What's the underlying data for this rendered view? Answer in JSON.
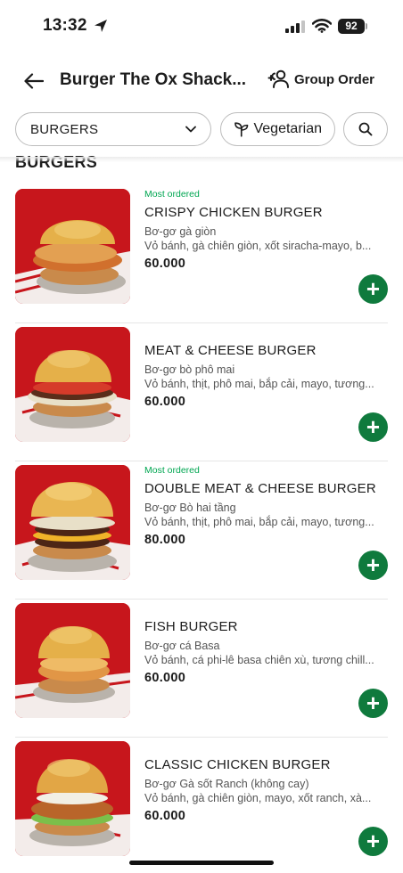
{
  "status_bar": {
    "time": "13:32",
    "battery": "92"
  },
  "header": {
    "title": "Burger The Ox Shack...",
    "group_order_label": "Group Order"
  },
  "filters": {
    "category": "BURGERS",
    "vegetarian_label": "Vegetarian"
  },
  "section": {
    "title": "BURGERS"
  },
  "items": [
    {
      "tag": "Most ordered",
      "name": "CRISPY CHICKEN BURGER",
      "subtitle": "Bơ-gơ gà giòn",
      "description": "Vỏ bánh, gà chiên giòn, xốt siracha-mayo, b...",
      "price": "60.000"
    },
    {
      "tag": "",
      "name": "MEAT & CHEESE BURGER",
      "subtitle": "Bơ-gơ bò phô mai",
      "description": "Vỏ bánh, thịt, phô mai, bắp cải, mayo, tương...",
      "price": "60.000"
    },
    {
      "tag": "Most ordered",
      "name": "DOUBLE MEAT & CHEESE BURGER",
      "subtitle": "Bơ-gơ Bò hai tầng",
      "description": "Vỏ bánh, thịt, phô mai, bắp cải, mayo, tương...",
      "price": "80.000"
    },
    {
      "tag": "",
      "name": "FISH BURGER",
      "subtitle": "Bơ-gơ cá Basa",
      "description": "Vỏ bánh, cá phi-lê basa chiên xù, tương chill...",
      "price": "60.000"
    },
    {
      "tag": "",
      "name": "CLASSIC CHICKEN BURGER",
      "subtitle": "Bơ-gơ Gà sốt Ranch (không cay)",
      "description": "Vỏ bánh, gà chiên giòn, mayo, xốt ranch, xà...",
      "price": "60.000"
    }
  ],
  "colors": {
    "accent": "#0f7a3d",
    "tag": "#00a651",
    "photo_bg": "#c7161c"
  },
  "icons": {
    "back": "arrow-left-icon",
    "group": "group-users-icon",
    "dropdown": "chevron-down-icon",
    "veg": "sprout-icon",
    "search": "search-icon",
    "add": "plus-icon"
  }
}
